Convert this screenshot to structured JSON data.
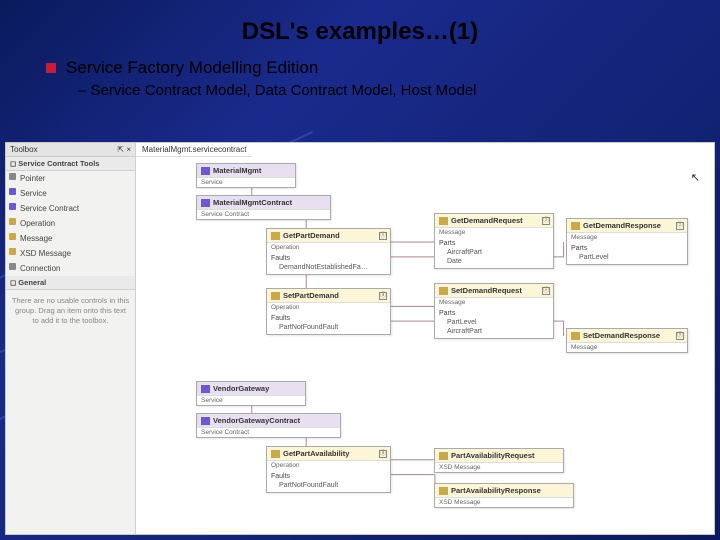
{
  "title": "DSL's examples…(1)",
  "bullet_main": "Service Factory Modelling Edition",
  "bullet_sub": "–  Service Contract Model, Data Contract Model, Host Model",
  "toolbox": {
    "header": "Toolbox",
    "pin": "⇱ ×",
    "section1": "◻ Service Contract Tools",
    "items": [
      {
        "label": "Pointer",
        "color": "#888"
      },
      {
        "label": "Service",
        "color": "#6a5acd"
      },
      {
        "label": "Service Contract",
        "color": "#6a5acd"
      },
      {
        "label": "Operation",
        "color": "#c9a94a"
      },
      {
        "label": "Message",
        "color": "#c9a94a"
      },
      {
        "label": "XSD Message",
        "color": "#c9a94a"
      },
      {
        "label": "Connection",
        "color": "#888"
      }
    ],
    "section2": "◻ General",
    "msg": "There are no usable controls in this group. Drag an item onto this text to add it to the toolbox."
  },
  "canvas": {
    "tab": "MaterialMgmt.servicecontract",
    "cursor_glyph": "↖"
  },
  "nodes": {
    "svc": {
      "name": "MaterialMgmt",
      "sub": "Service"
    },
    "contract1": {
      "name": "MaterialMgmtContract",
      "sub": "Service Contract"
    },
    "op1": {
      "name": "GetPartDemand",
      "sub": "Operation",
      "sect": "Faults",
      "item": "DemandNotEstablishedFa…",
      "chev": "ⓥ"
    },
    "op2": {
      "name": "SetPartDemand",
      "sub": "Operation",
      "sect": "Faults",
      "item": "PartNotFoundFault",
      "chev": "ⓐ"
    },
    "msg1": {
      "name": "GetDemandRequest",
      "sub": "Message",
      "sect": "Parts",
      "i1": "AircraftPart",
      "i2": "Date",
      "chev": "ⓩ"
    },
    "msg2": {
      "name": "GetDemandResponse",
      "sub": "Message",
      "sect": "Parts",
      "i1": "PartLevel",
      "chev": "ⓩ"
    },
    "msg3": {
      "name": "SetDemandRequest",
      "sub": "Message",
      "sect": "Parts",
      "i1": "PartLevel",
      "i2": "AircraftPart",
      "chev": "ⓥ"
    },
    "msg4": {
      "name": "SetDemandResponse",
      "sub": "Message",
      "chev": "ⓨ"
    },
    "svc2": {
      "name": "VendorGateway",
      "sub": "Service"
    },
    "contract2": {
      "name": "VendorGatewayContract",
      "sub": "Service Contract"
    },
    "op3": {
      "name": "GetPartAvailability",
      "sub": "Operation",
      "sect": "Faults",
      "item": "PartNotFoundFault",
      "chev": "ⓐ"
    },
    "xmsg1": {
      "name": "PartAvailabilityRequest",
      "sub": "XSD Message"
    },
    "xmsg2": {
      "name": "PartAvailabilityResponse",
      "sub": "XSD Message"
    }
  }
}
